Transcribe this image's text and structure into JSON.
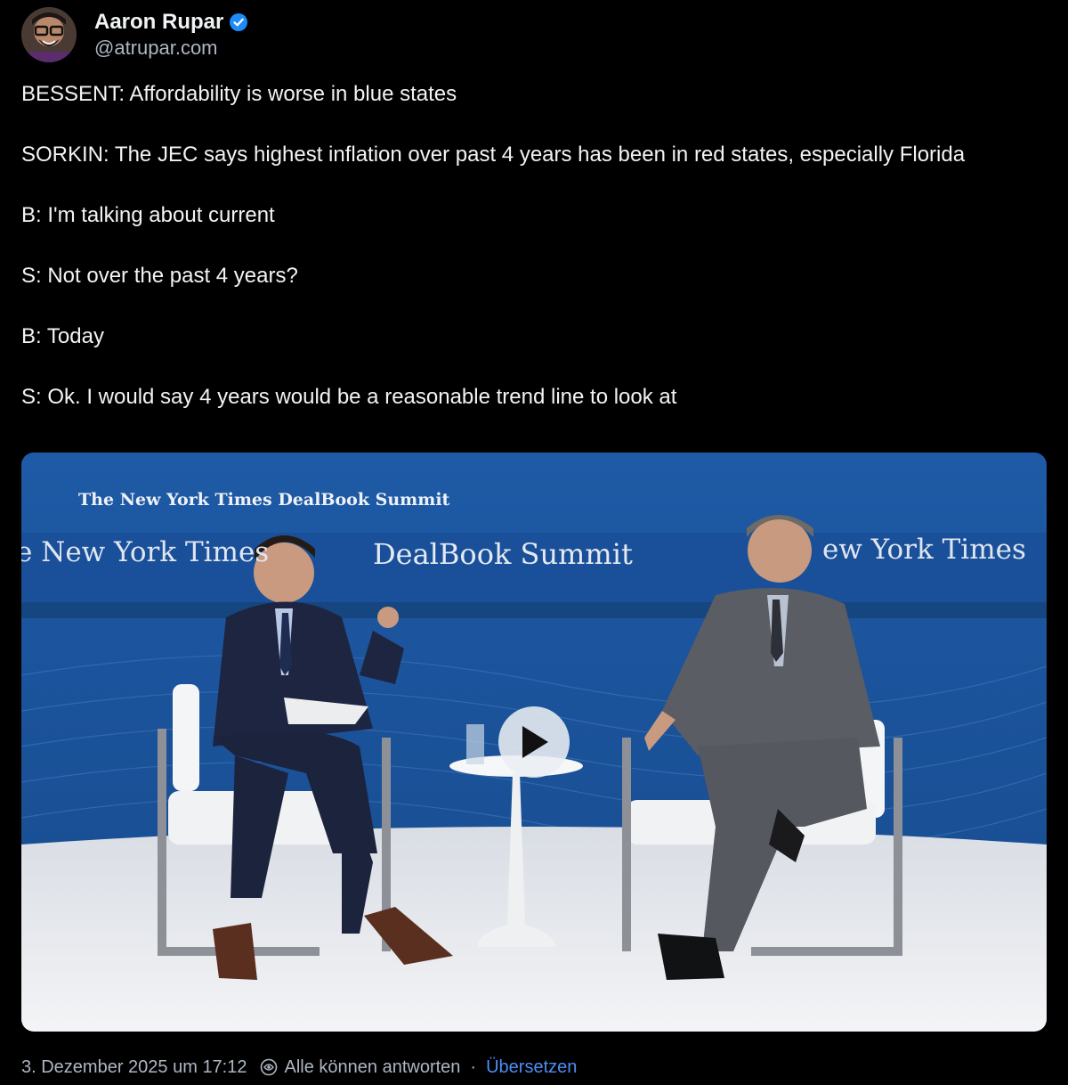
{
  "author": {
    "name": "Aaron Rupar",
    "handle": "@atrupar.com",
    "verified": true,
    "avatar_icon": "avatar-image"
  },
  "post": {
    "paragraphs": [
      "BESSENT: Affordability is worse in blue states",
      "SORKIN: The JEC says highest inflation over past 4 years has been in red states, especially Florida",
      "B: I'm talking about current",
      "S: Not over the past 4 years?",
      "B: Today",
      "S: Ok. I would say 4 years would be a reasonable trend line to look at"
    ]
  },
  "video": {
    "stage_small_text": "The New York Times DealBook Summit",
    "banner_left": "e New York Times",
    "banner_center": "DealBook Summit",
    "banner_right": "ew York Times",
    "play_icon": "play-icon"
  },
  "footer": {
    "timestamp": "3. Dezember 2025 um 17:12",
    "reply_setting": "Alle können antworten",
    "separator": "·",
    "translate_label": "Übersetzen"
  },
  "colors": {
    "background": "#000000",
    "text": "#f1f3f5",
    "muted": "#aeb6c2",
    "link": "#4c8ff3",
    "verified": "#1d8cf8",
    "stage_blue": "#1b4f93"
  }
}
